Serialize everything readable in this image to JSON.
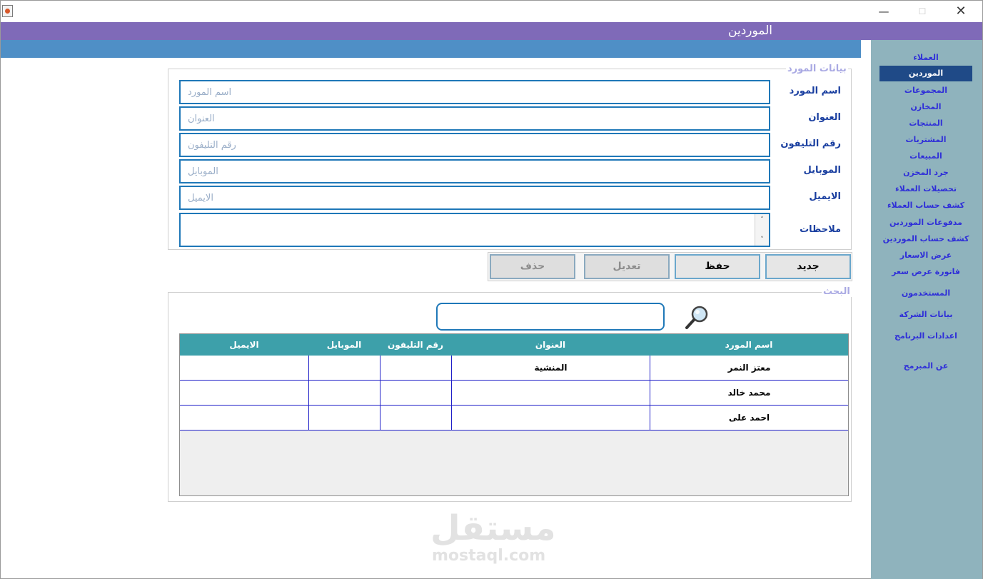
{
  "window": {
    "minimize_glyph": "—",
    "maximize_glyph": "☐",
    "close_glyph": "✕"
  },
  "header": {
    "title": "الموردين"
  },
  "sidebar": {
    "items": [
      {
        "label": "العملاء",
        "active": false
      },
      {
        "label": "الموردين",
        "active": true
      },
      {
        "label": "المجموعات",
        "active": false
      },
      {
        "label": "المخازن",
        "active": false
      },
      {
        "label": "المنتجات",
        "active": false
      },
      {
        "label": "المشتريات",
        "active": false
      },
      {
        "label": "المبيعات",
        "active": false
      },
      {
        "label": "جرد المخزن",
        "active": false
      },
      {
        "label": "تحصيلات العملاء",
        "active": false
      },
      {
        "label": "كشف حساب العملاء",
        "active": false
      },
      {
        "label": "مدفوعات  الموردين",
        "active": false
      },
      {
        "label": "كشف حساب  الموردين",
        "active": false
      },
      {
        "label": "عرض الاسعار",
        "active": false
      },
      {
        "label": "فاتورة عرض سعر",
        "active": false
      },
      {
        "label": "المستخدمون",
        "active": false
      },
      {
        "label": "بيانات الشركة",
        "active": false
      },
      {
        "label": "اعدادات البرنامج",
        "active": false
      },
      {
        "label": "عن المبرمج",
        "active": false
      }
    ]
  },
  "form": {
    "legend": "بيانات المورد",
    "fields": [
      {
        "label": "اسم المورد",
        "placeholder": "اسم المورد",
        "value": ""
      },
      {
        "label": "العنوان",
        "placeholder": "العنوان",
        "value": ""
      },
      {
        "label": "رقم التليفون",
        "placeholder": "رقم التليفون",
        "value": ""
      },
      {
        "label": "الموبايل",
        "placeholder": "الموبايل",
        "value": ""
      },
      {
        "label": "الايميل",
        "placeholder": "الايميل",
        "value": ""
      }
    ],
    "notes_label": "ملاحظات",
    "notes_value": "",
    "scroll_up": "˄",
    "scroll_down": "˅"
  },
  "actions": {
    "new_label": "جديد",
    "save_label": "حفظ",
    "edit_label": "تعديل",
    "delete_label": "حذف"
  },
  "search": {
    "legend": "البحث",
    "value": ""
  },
  "table": {
    "columns": [
      "اسم المورد",
      "العنوان",
      "رقم التليفون",
      "الموبايل",
      "الايميل"
    ],
    "rows": [
      [
        "معتز النمر",
        "المنشية",
        "",
        "",
        ""
      ],
      [
        "محمد خالد",
        "",
        "",
        "",
        ""
      ],
      [
        "احمد على",
        "",
        "",
        "",
        ""
      ]
    ]
  },
  "watermark": {
    "arabic": "مستقل",
    "latin": "mostaql.com"
  },
  "colors": {
    "header_bar": "#7f6ab8",
    "blue_strip": "#4f8fc6",
    "sidebar_bg": "#8fb3bd",
    "sidebar_active": "#1f4a87",
    "table_header": "#3da0aa",
    "input_border": "#1f78b8"
  }
}
